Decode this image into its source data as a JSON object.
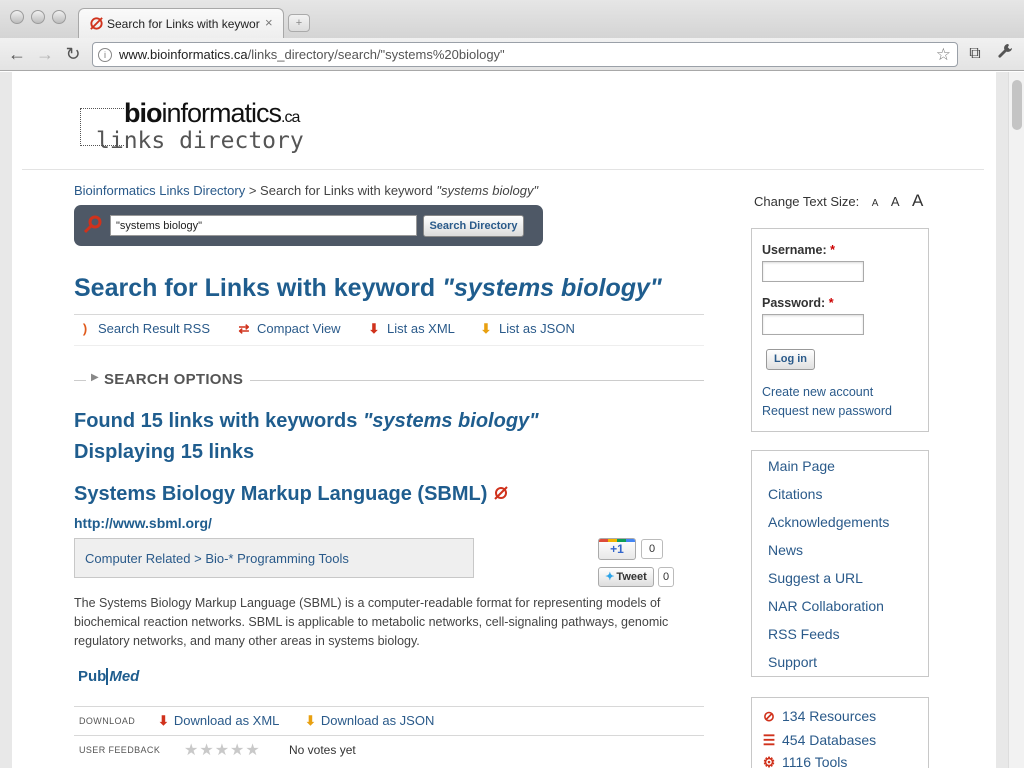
{
  "browser": {
    "tab_title": "Search for Links with keywor",
    "tab_close": "×",
    "new_tab": "+",
    "nav": {
      "back": "←",
      "forward": "→",
      "reload": "↻"
    },
    "url_host": "www.bioinformatics.ca",
    "url_path": "/links_directory/search/\"systems%20biology\"",
    "star": "☆",
    "icons": [
      "back-icon",
      "forward-icon",
      "reload-icon",
      "star-icon",
      "page-menu-icon",
      "wrench-icon"
    ],
    "menu_icon": "⧉",
    "wrench_icon": "🔧"
  },
  "logo": {
    "bio_bold": "bio",
    "bio_rest": "informatics",
    "ca": ".ca",
    "links": "links directory"
  },
  "breadcrumb": {
    "home": "Bioinformatics Links Directory",
    "sep": " > ",
    "current_prefix": "Search for Links with keyword ",
    "current_keyword": "\"systems biology\""
  },
  "search": {
    "value": "\"systems biology\"",
    "button": "Search Directory"
  },
  "page": {
    "title_prefix": "Search for Links with keyword ",
    "title_keyword": "\"systems biology\""
  },
  "tools": [
    {
      "label": "Search Result RSS",
      "icon": "rss-icon",
      "glyph": "⁾",
      "color": "#e05a1c"
    },
    {
      "label": "Compact View",
      "icon": "swap-arrows-icon",
      "glyph": "⇄",
      "color": "#d0321c"
    },
    {
      "label": "List as XML",
      "icon": "download-xml-icon",
      "glyph": "⬇",
      "color": "#d0321c"
    },
    {
      "label": "List as JSON",
      "icon": "download-json-icon",
      "glyph": "⬇",
      "color": "#e8a010"
    }
  ],
  "search_options": {
    "label": "SEARCH OPTIONS",
    "arrow": "▶"
  },
  "found": {
    "line1_prefix": "Found 15 links with keywords ",
    "line1_keyword": "\"systems biology\"",
    "line2": "Displaying 15 links"
  },
  "result": {
    "title": "Systems Biology Markup Language (SBML)",
    "url": "http://www.sbml.org/",
    "category": "Computer Related > Bio-* Programming Tools",
    "gplus_label": "+1",
    "gplus_count": "0",
    "tweet_label": "Tweet",
    "tweet_count": "0",
    "description": "The Systems Biology Markup Language (SBML) is a computer-readable format for representing models of biochemical reaction networks. SBML is applicable to metabolic networks, cell-signaling pathways, genomic regulatory networks, and many other areas in systems biology.",
    "pubmed_left": "Pub",
    "pubmed_right": "Med",
    "download_label": "DOWNLOAD",
    "download_xml": "Download as XML",
    "download_json": "Download as JSON",
    "feedback_label": "USER FEEDBACK",
    "stars": "★★★★★",
    "rating_stars_filled": 0,
    "rating_stars_total": 5,
    "votes": "No votes yet"
  },
  "sidebar": {
    "text_size_label": "Change Text Size:",
    "text_sizes": [
      "A",
      "A",
      "A"
    ],
    "login": {
      "username_label": "Username:",
      "password_label": "Password:",
      "required_mark": "*",
      "button": "Log in",
      "create_account": "Create new account",
      "request_password": "Request new password"
    },
    "nav": [
      "Main Page",
      "Citations",
      "Acknowledgements",
      "News",
      "Suggest a URL",
      "NAR Collaboration",
      "RSS Feeds",
      "Support"
    ],
    "stats": [
      {
        "label": "134 Resources",
        "icon": "resources-icon",
        "glyph": "⊘"
      },
      {
        "label": "454 Databases",
        "icon": "databases-icon",
        "glyph": "☰"
      },
      {
        "label": "1116 Tools",
        "icon": "tools-gear-icon",
        "glyph": "⚙"
      }
    ]
  },
  "colors": {
    "link": "#2a5a8a",
    "heading": "#1f5d8e",
    "search_bar": "#4e5866",
    "accent_red": "#d0321c"
  }
}
